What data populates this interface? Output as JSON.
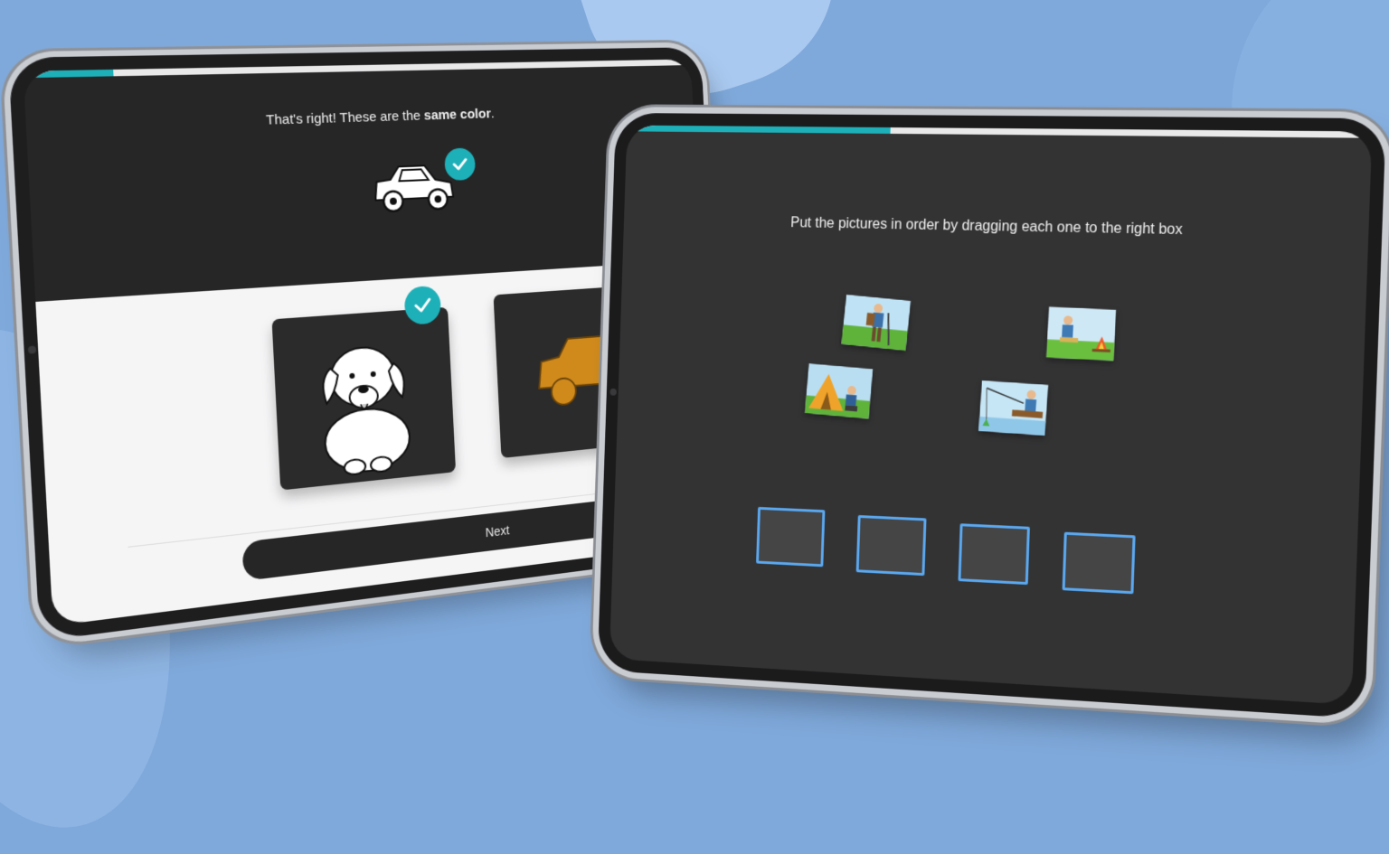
{
  "colors": {
    "background": "#7fa9db",
    "accent": "#1eb0b8",
    "drop_box_border": "#5aa8f0",
    "dark_screen": "#333334"
  },
  "left_tablet": {
    "progress_fraction": 0.12,
    "message_prefix": "That's right! These are the ",
    "message_bold": "same color",
    "message_suffix": ".",
    "target_icon": "car-outline-icon",
    "choices": [
      {
        "icon": "dog-outline-icon",
        "selected": true
      },
      {
        "icon": "orange-car-icon",
        "selected": false
      }
    ],
    "next_label": "Next"
  },
  "right_tablet": {
    "progress_fraction": 0.37,
    "instruction": "Put the pictures in order by dragging each one to the right box",
    "pictures": [
      {
        "icon": "hiker-picture-icon"
      },
      {
        "icon": "campfire-picture-icon"
      },
      {
        "icon": "tent-picture-icon"
      },
      {
        "icon": "fishing-picture-icon"
      }
    ],
    "drop_box_count": 4
  }
}
